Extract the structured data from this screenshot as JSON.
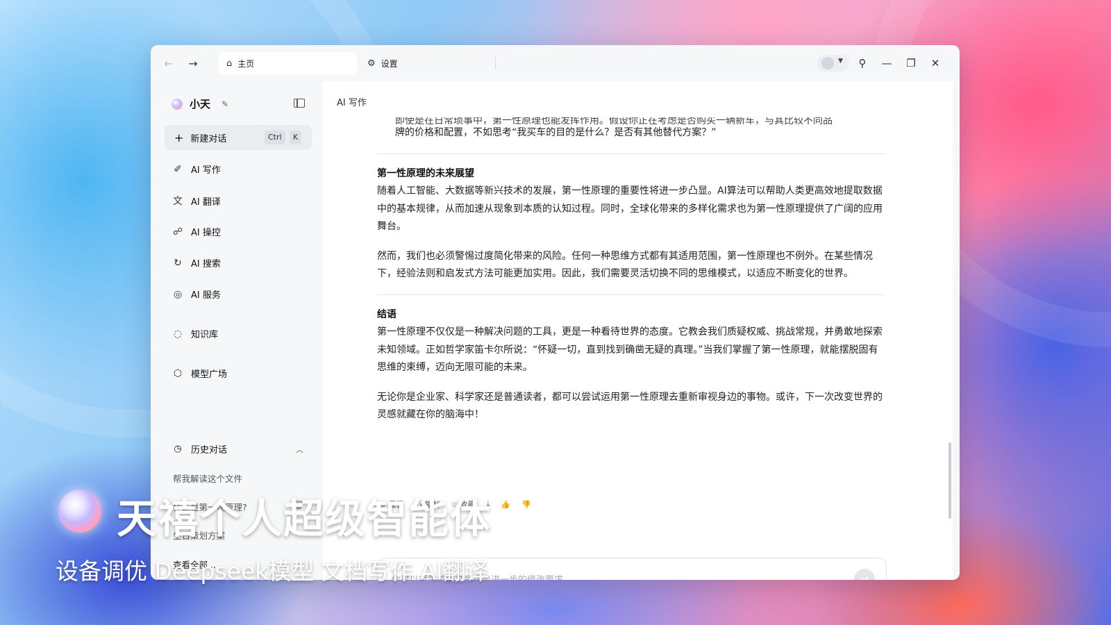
{
  "window": {
    "tabs": [
      {
        "label": "主页",
        "icon": "home-icon"
      },
      {
        "label": "设置",
        "icon": "gear-icon"
      }
    ]
  },
  "sidebar": {
    "brand": "小天",
    "new_chat": {
      "label": "新建对话",
      "shortcut": [
        "Ctrl",
        "K"
      ]
    },
    "items": [
      {
        "label": "AI 写作",
        "icon": "pen-icon"
      },
      {
        "label": "AI 翻译",
        "icon": "translate-icon"
      },
      {
        "label": "AI 操控",
        "icon": "control-icon"
      },
      {
        "label": "AI 搜索",
        "icon": "search-icon"
      },
      {
        "label": "AI 服务",
        "icon": "service-icon"
      },
      {
        "label": "知识库",
        "icon": "knowledge-icon"
      },
      {
        "label": "模型广场",
        "icon": "cube-icon"
      }
    ],
    "history": {
      "title": "历史对话",
      "items": [
        "帮我解读这个文件",
        "什么是第一性原理?",
        "生日策划方案"
      ],
      "view_all": "查看全部..."
    }
  },
  "main": {
    "title": "AI 写作",
    "cut_text": "即使是在日常琐事中，第一性原理也能发挥作用。假设你正在考虑是否购买一辆新车，与其比较不同品",
    "first_para_tail": "牌的价格和配置，不如思考“我买车的目的是什么？是否有其他替代方案？”",
    "sec1_title": "第一性原理的未来展望",
    "sec1_p1": "随着人工智能、大数据等新兴技术的发展，第一性原理的重要性将进一步凸显。AI算法可以帮助人类更高效地提取数据中的基本规律，从而加速从现象到本质的认知过程。同时，全球化带来的多样化需求也为第一性原理提供了广阔的应用舞台。",
    "sec1_p2": "然而，我们也必须警惕过度简化带来的风险。任何一种思维方式都有其适用范围，第一性原理也不例外。在某些情况下，经验法则和启发式方法可能更加实用。因此，我们需要灵活切换不同的思维模式，以适应不断变化的世界。",
    "sec2_title": "结语",
    "sec2_p1": "第一性原理不仅仅是一种解决问题的工具，更是一种看待世界的态度。它教会我们质疑权威、挑战常规，并勇敢地探索未知领域。正如哲学家笛卡尔所说：“怀疑一切，直到找到确凿无疑的真理。”当我们掌握了第一性原理，就能摆脱固有思维的束缚，迈向无限可能的未来。",
    "sec2_p2": "无论你是企业家、科学家还是普通读者，都可以尝试运用第一性原理去重新审视身边的事物。或许，下一次改变世界的灵感就藏在你的脑海中！",
    "actions": [
      {
        "label": "重答",
        "icon": "refresh-icon"
      },
      {
        "label": "复制",
        "icon": "copy-icon"
      },
      {
        "label": "收藏",
        "icon": "bookmark-icon"
      }
    ],
    "input_placeholder": "你可以对生成的文章提出进一步的修改要求"
  },
  "overlay": {
    "title": "天禧个人超级智能体",
    "subtitle": "设备调优  Deepseek模型  文档写作  AI翻译"
  }
}
